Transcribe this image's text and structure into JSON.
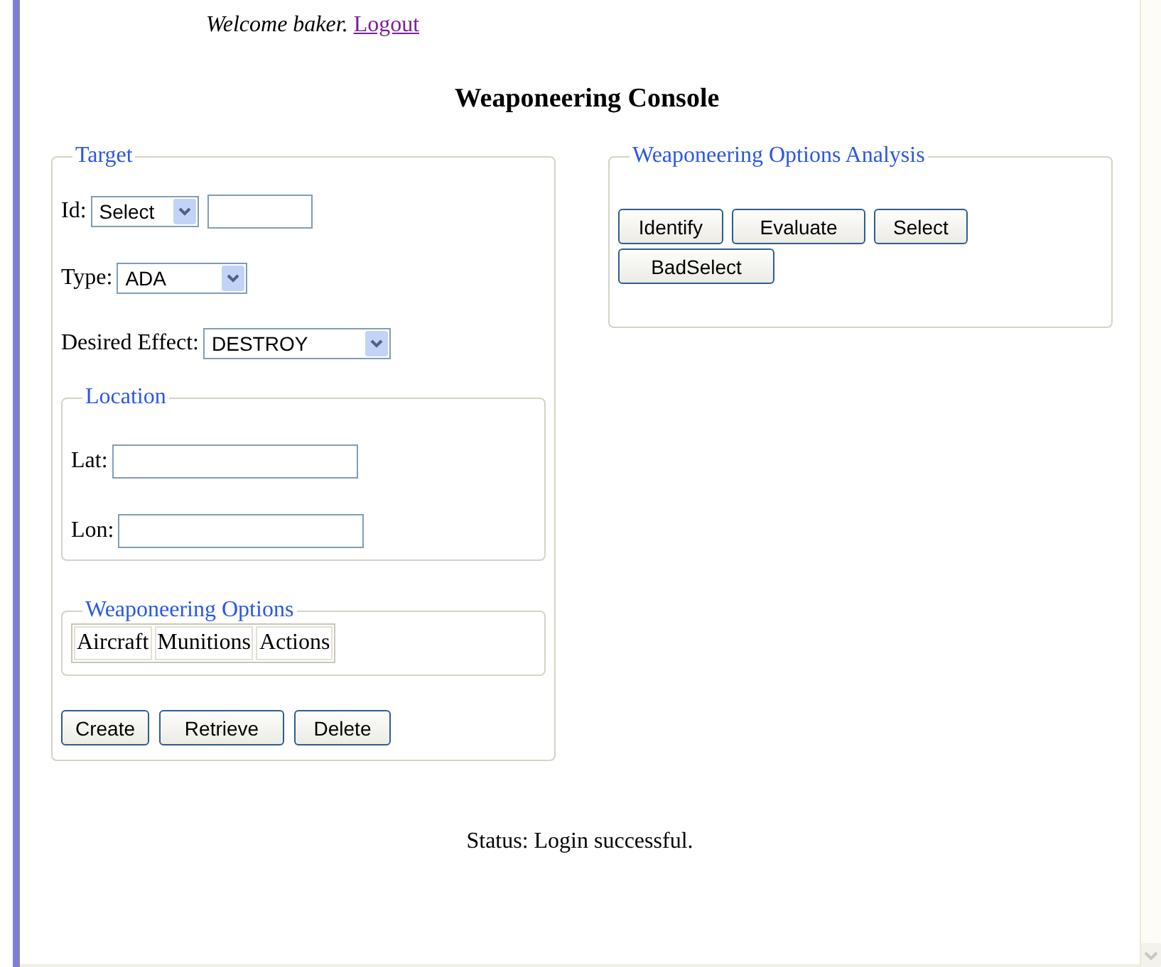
{
  "welcome": {
    "text": "Welcome baker.",
    "link": "Logout"
  },
  "title": "Weaponeering Console",
  "target": {
    "legend": "Target",
    "id": {
      "label": "Id:",
      "select": "Select"
    },
    "type": {
      "label": "Type:",
      "select": "ADA"
    },
    "effect": {
      "label": "Desired Effect:",
      "select": "DESTROY"
    },
    "location": {
      "legend": "Location",
      "fields": [
        {
          "label": "Lat:"
        },
        {
          "label": "Lon:"
        }
      ]
    },
    "options": {
      "legend": "Weaponeering Options",
      "tabs": [
        "Aircraft",
        "Munitions",
        "Actions"
      ]
    },
    "buttons": [
      "Create",
      "Retrieve",
      "Delete"
    ]
  },
  "analysis": {
    "legend": "Weaponeering Options Analysis",
    "buttons": [
      "Identify",
      "Evaluate",
      "Select",
      "BadSelect"
    ]
  },
  "status": "Status: Login successful."
}
